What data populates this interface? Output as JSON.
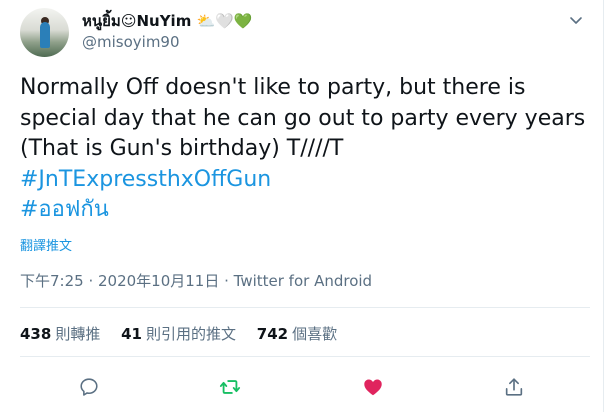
{
  "user": {
    "display_name": "หนูยิ้ม☺NuYim ⛅🤍💚",
    "handle": "@misoyim90"
  },
  "tweet": {
    "line1": "Normally Off doesn't like to party, but there is",
    "line2": "special day that he can go out to party every years",
    "line3": "(That is Gun's birthday) T////T",
    "hashtag1": "#JnTExpressthxOffGun",
    "hashtag2": "#ออฟกัน"
  },
  "translate_label": "翻譯推文",
  "meta": "下午7:25 · 2020年10月11日 · Twitter for Android",
  "stats": {
    "retweets_count": "438",
    "retweets_label": "則轉推",
    "quotes_count": "41",
    "quotes_label": "則引用的推文",
    "likes_count": "742",
    "likes_label": "個喜歡"
  },
  "colors": {
    "accent": "#1b95e0",
    "secondary_text": "#5b7083",
    "retweet_green": "#17bf63",
    "like_red": "#e0245e"
  },
  "icons": [
    "chevron-down-icon",
    "reply-icon",
    "retweet-icon",
    "like-icon",
    "share-icon"
  ]
}
